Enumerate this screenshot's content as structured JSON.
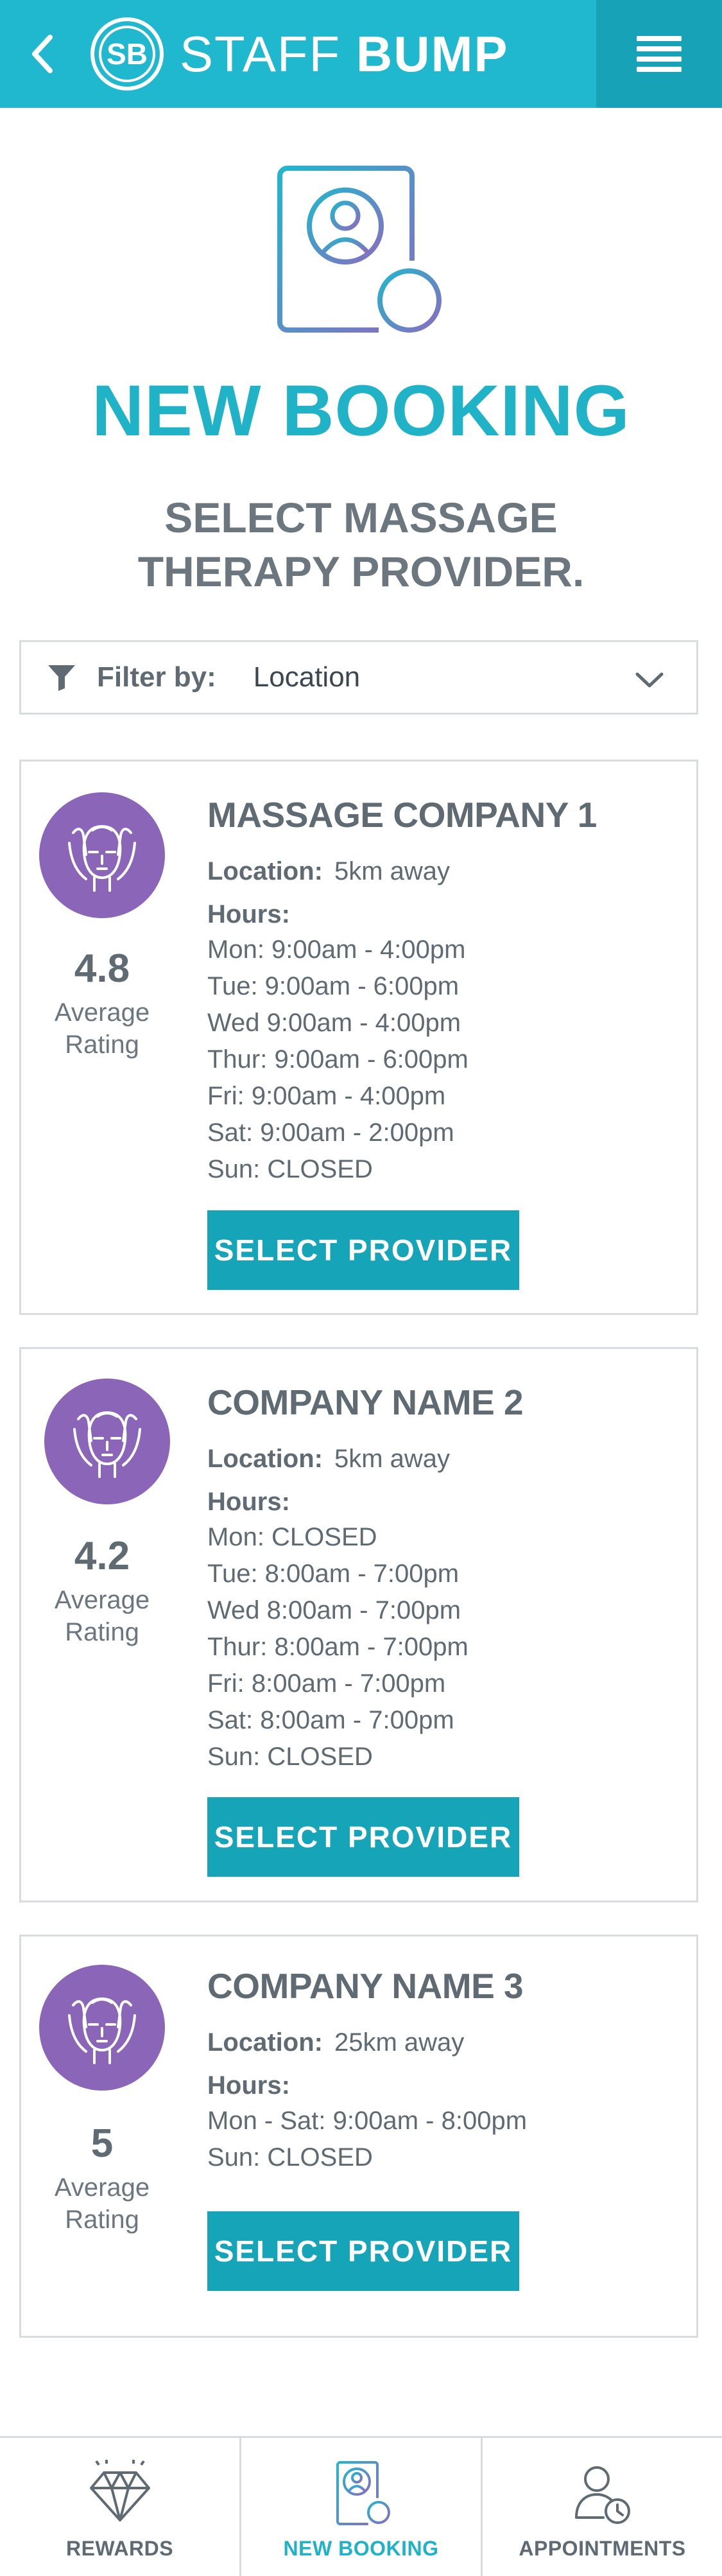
{
  "header": {
    "logo_initials": "SB",
    "brand_light": "STAFF",
    "brand_bold": "BUMP",
    "back_icon": "chevron-left-icon",
    "menu_icon": "hamburger-menu-icon"
  },
  "page": {
    "title": "NEW BOOKING",
    "subtitle_line1": "SELECT MASSAGE",
    "subtitle_line2": "THERAPY PROVIDER."
  },
  "filter": {
    "label": "Filter by:",
    "value": "Location",
    "icon": "funnel-icon"
  },
  "providers": [
    {
      "name": "MASSAGE COMPANY 1",
      "location_label": "Location:",
      "location": "5km away",
      "hours_label": "Hours:",
      "hours": [
        "Mon: 9:00am - 4:00pm",
        "Tue: 9:00am - 6:00pm",
        "Wed 9:00am - 4:00pm",
        "Thur: 9:00am - 6:00pm",
        "Fri: 9:00am - 4:00pm",
        "Sat: 9:00am - 2:00pm",
        "Sun: CLOSED"
      ],
      "rating": "4.8",
      "rating_label_1": "Average",
      "rating_label_2": "Rating",
      "button": "SELECT PROVIDER"
    },
    {
      "name": "COMPANY NAME 2",
      "location_label": "Location:",
      "location": "5km away",
      "hours_label": "Hours:",
      "hours": [
        "Mon: CLOSED",
        "Tue: 8:00am - 7:00pm",
        "Wed 8:00am - 7:00pm",
        "Thur: 8:00am - 7:00pm",
        "Fri: 8:00am - 7:00pm",
        "Sat: 8:00am - 7:00pm",
        "Sun: CLOSED"
      ],
      "rating": "4.2",
      "rating_label_1": "Average",
      "rating_label_2": "Rating",
      "button": "SELECT PROVIDER"
    },
    {
      "name": "COMPANY NAME 3",
      "location_label": "Location:",
      "location": "25km away",
      "hours_label": "Hours:",
      "hours": [
        "Mon - Sat: 9:00am - 8:00pm",
        "Sun: CLOSED"
      ],
      "rating": "5",
      "rating_label_1": "Average",
      "rating_label_2": "Rating",
      "button": "SELECT PROVIDER"
    }
  ],
  "bottom_nav": [
    {
      "label": "REWARDS",
      "icon": "diamond-icon",
      "active": false
    },
    {
      "label": "NEW BOOKING",
      "icon": "new-booking-icon",
      "active": true
    },
    {
      "label": "APPOINTMENTS",
      "icon": "appointments-icon",
      "active": false
    }
  ],
  "colors": {
    "brand": "#20b8cf",
    "brand_dark": "#18a2b7",
    "button": "#15a4b8",
    "avatar": "#8b66b8",
    "text": "#5f6a72"
  }
}
